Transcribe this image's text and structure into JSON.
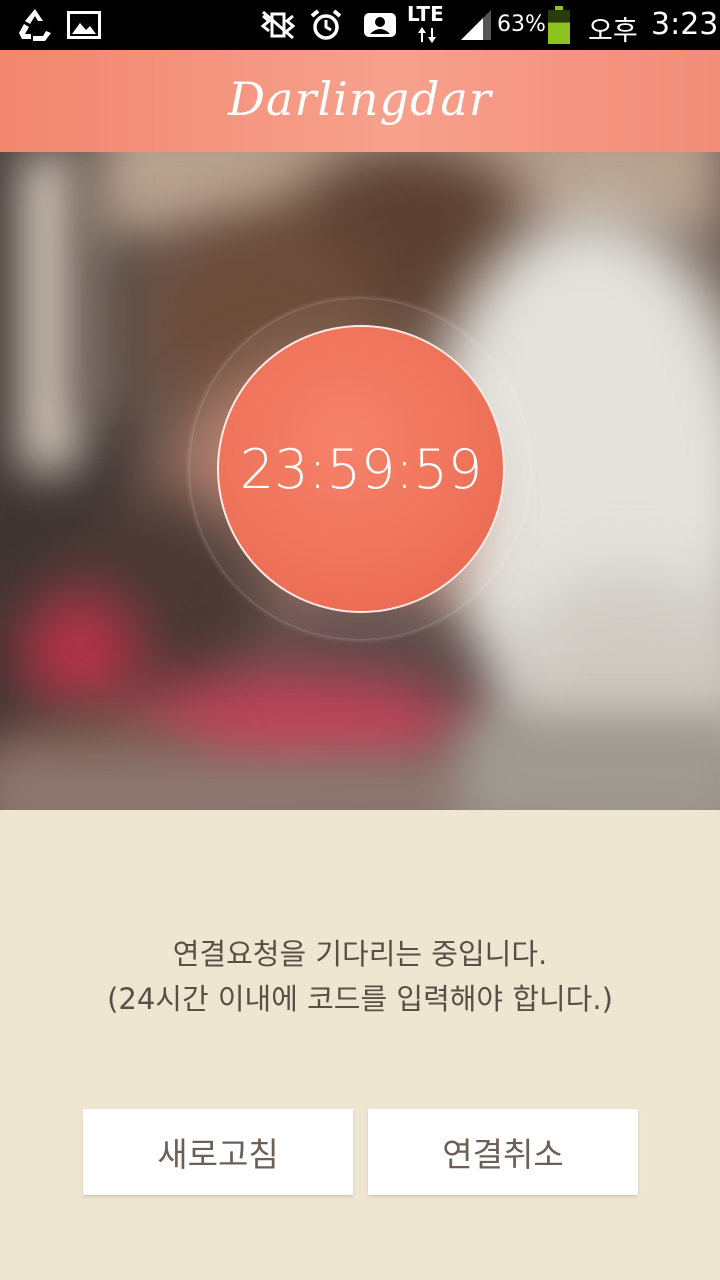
{
  "status_bar": {
    "battery_percent": "63%",
    "network": "LTE",
    "time_period": "오후",
    "time": "3:23",
    "icons": [
      "recycle-icon",
      "image-icon",
      "mute-icon",
      "alarm-icon",
      "voicemail-icon",
      "data-arrows-icon",
      "signal-icon",
      "battery-icon"
    ],
    "battery_level": 0.63,
    "battery_color": "#8dc21f"
  },
  "header": {
    "title": "Darlingdar",
    "color": "#f59480"
  },
  "timer": {
    "value": "23:59:59",
    "color": "#ef735a"
  },
  "message": {
    "line1": "연결요청을 기다리는 중입니다.",
    "line2": "(24시간 이내에 코드를 입력해야 합니다.)"
  },
  "buttons": {
    "refresh_label": "새로고침",
    "cancel_label": "연결취소"
  },
  "colors": {
    "panel_background": "#efe6d2",
    "text": "#5a4f46"
  }
}
